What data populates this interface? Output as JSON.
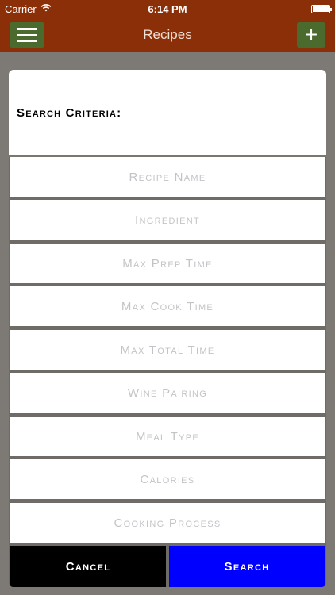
{
  "status_bar": {
    "carrier": "Carrier",
    "time": "6:14 PM"
  },
  "nav": {
    "title": "Recipes"
  },
  "modal": {
    "title": "Search Criteria:",
    "fields": [
      {
        "placeholder": "Recipe Name"
      },
      {
        "placeholder": "Ingredient"
      },
      {
        "placeholder": "Max Prep Time"
      },
      {
        "placeholder": "Max Cook Time"
      },
      {
        "placeholder": "Max Total Time"
      },
      {
        "placeholder": "Wine Pairing"
      },
      {
        "placeholder": "Meal Type"
      },
      {
        "placeholder": "Calories"
      },
      {
        "placeholder": "Cooking Process"
      }
    ],
    "cancel_label": "Cancel",
    "search_label": "Search"
  },
  "colors": {
    "nav_background": "#8a2f08",
    "nav_button": "#4a6a2e",
    "cancel_button": "#000000",
    "search_button": "#0000ff"
  },
  "icons": {
    "menu": "hamburger-icon",
    "add": "plus-icon",
    "wifi": "wifi-icon",
    "battery": "battery-icon"
  }
}
